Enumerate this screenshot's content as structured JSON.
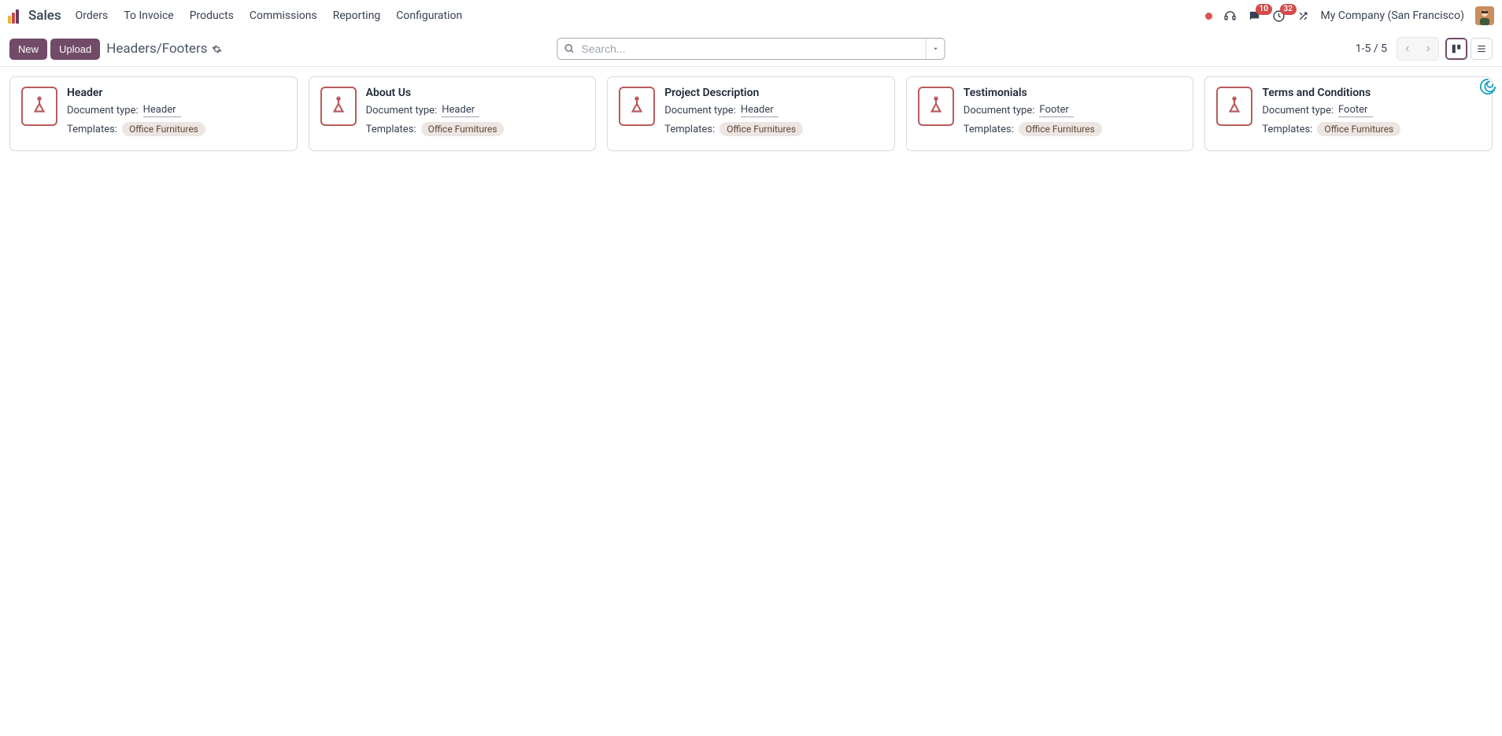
{
  "app": {
    "name": "Sales"
  },
  "nav": {
    "items": [
      "Orders",
      "To Invoice",
      "Products",
      "Commissions",
      "Reporting",
      "Configuration"
    ]
  },
  "header_right": {
    "messages_badge": "10",
    "activities_badge": "32",
    "company": "My Company (San Francisco)"
  },
  "control": {
    "new_label": "New",
    "upload_label": "Upload",
    "breadcrumb": "Headers/Footers",
    "search_placeholder": "Search...",
    "pager": "1-5 / 5"
  },
  "labels": {
    "doc_type": "Document type:",
    "templates": "Templates:"
  },
  "cards": [
    {
      "title": "Header",
      "doc_type": "Header",
      "template": "Office Furnitures"
    },
    {
      "title": "About Us",
      "doc_type": "Header",
      "template": "Office Furnitures"
    },
    {
      "title": "Project Description",
      "doc_type": "Header",
      "template": "Office Furnitures"
    },
    {
      "title": "Testimonials",
      "doc_type": "Footer",
      "template": "Office Furnitures"
    },
    {
      "title": "Terms and Conditions",
      "doc_type": "Footer",
      "template": "Office Furnitures"
    }
  ]
}
